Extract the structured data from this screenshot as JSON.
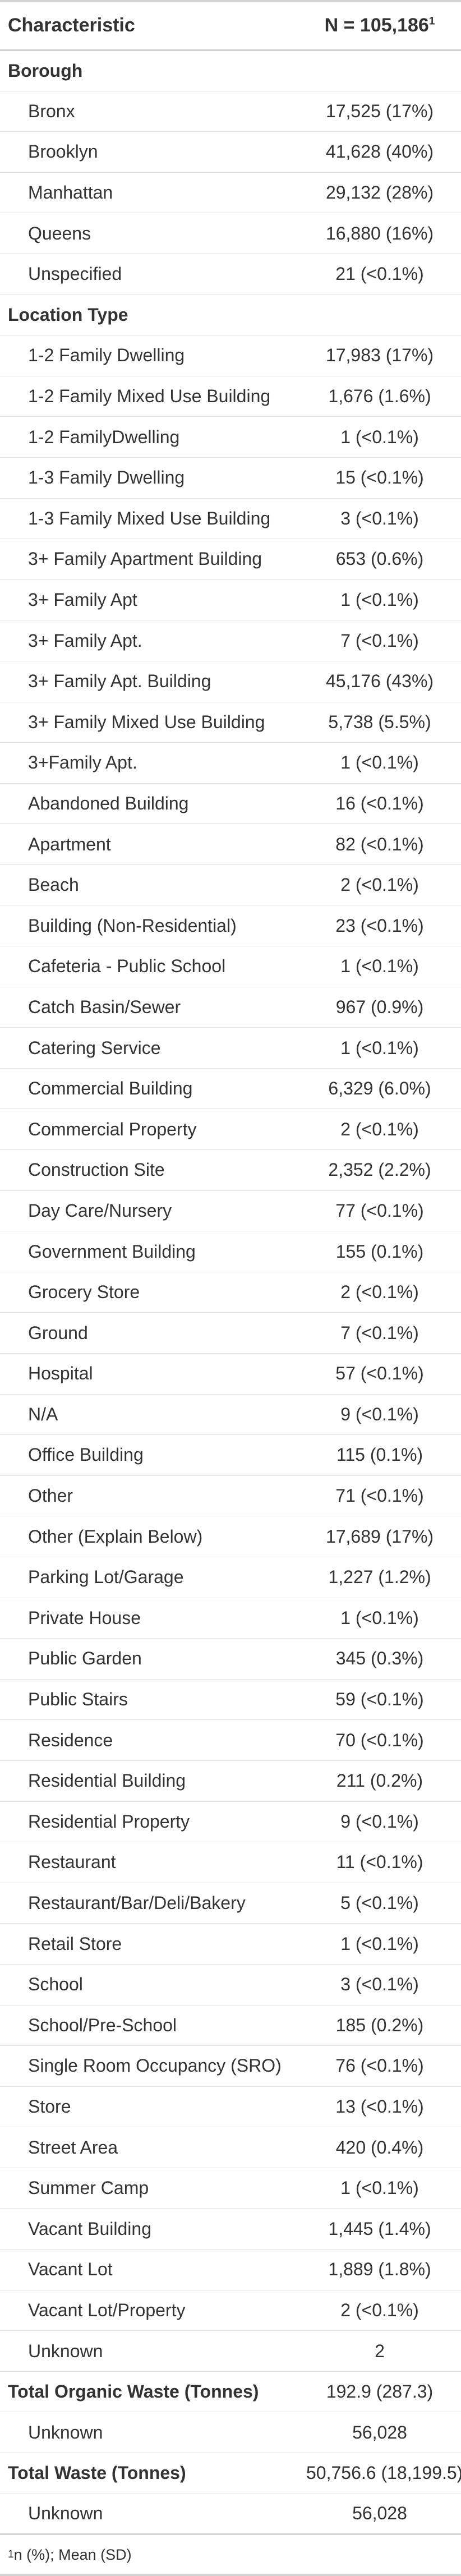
{
  "header": {
    "characteristic": "Characteristic",
    "n_label": "N = 105,186",
    "n_sup": "1"
  },
  "rows": [
    {
      "label": "Borough",
      "value": "",
      "group": true
    },
    {
      "label": "Bronx",
      "value": "17,525 (17%)"
    },
    {
      "label": "Brooklyn",
      "value": "41,628 (40%)"
    },
    {
      "label": "Manhattan",
      "value": "29,132 (28%)"
    },
    {
      "label": "Queens",
      "value": "16,880 (16%)"
    },
    {
      "label": "Unspecified",
      "value": "21 (<0.1%)"
    },
    {
      "label": "Location Type",
      "value": "",
      "group": true
    },
    {
      "label": "1-2 Family Dwelling",
      "value": "17,983 (17%)"
    },
    {
      "label": "1-2 Family Mixed Use Building",
      "value": "1,676 (1.6%)"
    },
    {
      "label": "1-2 FamilyDwelling",
      "value": "1 (<0.1%)"
    },
    {
      "label": "1-3 Family Dwelling",
      "value": "15 (<0.1%)"
    },
    {
      "label": "1-3 Family Mixed Use Building",
      "value": "3 (<0.1%)"
    },
    {
      "label": "3+ Family Apartment Building",
      "value": "653 (0.6%)"
    },
    {
      "label": "3+ Family Apt",
      "value": "1 (<0.1%)"
    },
    {
      "label": "3+ Family Apt.",
      "value": "7 (<0.1%)"
    },
    {
      "label": "3+ Family Apt. Building",
      "value": "45,176 (43%)"
    },
    {
      "label": "3+ Family Mixed Use Building",
      "value": "5,738 (5.5%)"
    },
    {
      "label": "3+Family Apt.",
      "value": "1 (<0.1%)"
    },
    {
      "label": "Abandoned Building",
      "value": "16 (<0.1%)"
    },
    {
      "label": "Apartment",
      "value": "82 (<0.1%)"
    },
    {
      "label": "Beach",
      "value": "2 (<0.1%)"
    },
    {
      "label": "Building (Non-Residential)",
      "value": "23 (<0.1%)"
    },
    {
      "label": "Cafeteria - Public School",
      "value": "1 (<0.1%)"
    },
    {
      "label": "Catch Basin/Sewer",
      "value": "967 (0.9%)"
    },
    {
      "label": "Catering Service",
      "value": "1 (<0.1%)"
    },
    {
      "label": "Commercial Building",
      "value": "6,329 (6.0%)"
    },
    {
      "label": "Commercial Property",
      "value": "2 (<0.1%)"
    },
    {
      "label": "Construction Site",
      "value": "2,352 (2.2%)"
    },
    {
      "label": "Day Care/Nursery",
      "value": "77 (<0.1%)"
    },
    {
      "label": "Government Building",
      "value": "155 (0.1%)"
    },
    {
      "label": "Grocery Store",
      "value": "2 (<0.1%)"
    },
    {
      "label": "Ground",
      "value": "7 (<0.1%)"
    },
    {
      "label": "Hospital",
      "value": "57 (<0.1%)"
    },
    {
      "label": "N/A",
      "value": "9 (<0.1%)"
    },
    {
      "label": "Office Building",
      "value": "115 (0.1%)"
    },
    {
      "label": "Other",
      "value": "71 (<0.1%)"
    },
    {
      "label": "Other (Explain Below)",
      "value": "17,689 (17%)"
    },
    {
      "label": "Parking Lot/Garage",
      "value": "1,227 (1.2%)"
    },
    {
      "label": "Private House",
      "value": "1 (<0.1%)"
    },
    {
      "label": "Public Garden",
      "value": "345 (0.3%)"
    },
    {
      "label": "Public Stairs",
      "value": "59 (<0.1%)"
    },
    {
      "label": "Residence",
      "value": "70 (<0.1%)"
    },
    {
      "label": "Residential Building",
      "value": "211 (0.2%)"
    },
    {
      "label": "Residential Property",
      "value": "9 (<0.1%)"
    },
    {
      "label": "Restaurant",
      "value": "11 (<0.1%)"
    },
    {
      "label": "Restaurant/Bar/Deli/Bakery",
      "value": "5 (<0.1%)"
    },
    {
      "label": "Retail Store",
      "value": "1 (<0.1%)"
    },
    {
      "label": "School",
      "value": "3 (<0.1%)"
    },
    {
      "label": "School/Pre-School",
      "value": "185 (0.2%)"
    },
    {
      "label": "Single Room Occupancy (SRO)",
      "value": "76 (<0.1%)"
    },
    {
      "label": "Store",
      "value": "13 (<0.1%)"
    },
    {
      "label": "Street Area",
      "value": "420 (0.4%)"
    },
    {
      "label": "Summer Camp",
      "value": "1 (<0.1%)"
    },
    {
      "label": "Vacant Building",
      "value": "1,445 (1.4%)"
    },
    {
      "label": "Vacant Lot",
      "value": "1,889 (1.8%)"
    },
    {
      "label": "Vacant Lot/Property",
      "value": "2 (<0.1%)"
    },
    {
      "label": "Unknown",
      "value": "2"
    },
    {
      "label": "Total Organic Waste (Tonnes)",
      "value": "192.9 (287.3)",
      "group": true
    },
    {
      "label": "Unknown",
      "value": "56,028"
    },
    {
      "label": "Total Waste (Tonnes)",
      "value": "50,756.6 (18,199.5)",
      "group": true
    },
    {
      "label": "Unknown",
      "value": "56,028"
    }
  ],
  "footnote": {
    "sup": "1",
    "text": "n (%); Mean (SD)"
  }
}
